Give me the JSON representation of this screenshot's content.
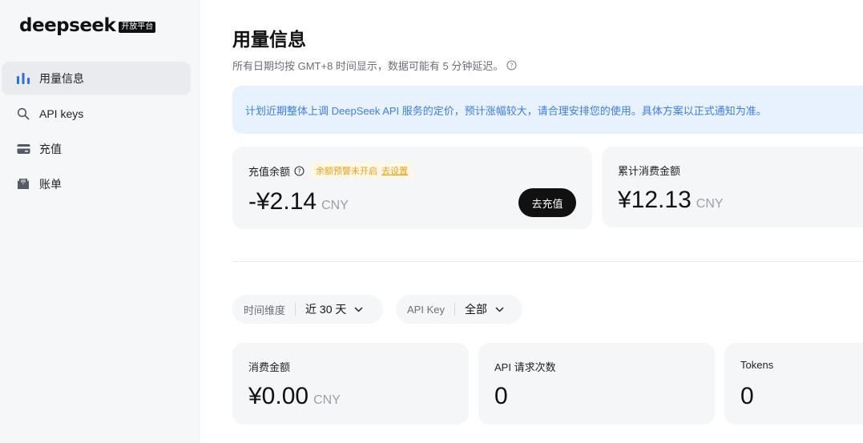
{
  "brand": {
    "name": "deepseek",
    "badge": "开放平台"
  },
  "sidebar": {
    "items": [
      {
        "label": "用量信息",
        "icon": "bar-chart-icon",
        "active": true
      },
      {
        "label": "API keys",
        "icon": "search-icon",
        "active": false
      },
      {
        "label": "充值",
        "icon": "wallet-icon",
        "active": false
      },
      {
        "label": "账单",
        "icon": "bill-icon",
        "active": false
      }
    ]
  },
  "header": {
    "title": "用量信息",
    "subtitle": "所有日期均按 GMT+8 时间显示，数据可能有 5 分钟延迟。"
  },
  "notice": {
    "text": "计划近期整体上调 DeepSeek API 服务的定价，预计涨幅较大，请合理安排您的使用。具体方案以正式通知为准。"
  },
  "balance": {
    "label": "充值余额",
    "warning": "余额预警未开启",
    "warning_link": "去设置",
    "value": "-¥2.14",
    "unit": "CNY",
    "button": "去充值"
  },
  "total_spend": {
    "label": "累计消费金额",
    "value": "¥12.13",
    "unit": "CNY"
  },
  "filters": {
    "time": {
      "key": "时间维度",
      "value": "近 30 天"
    },
    "api_key": {
      "key": "API Key",
      "value": "全部"
    }
  },
  "stats": {
    "spend": {
      "label": "消费金额",
      "value": "¥0.00",
      "unit": "CNY"
    },
    "requests": {
      "label": "API 请求次数",
      "value": "0"
    },
    "tokens": {
      "label": "Tokens",
      "value": "0"
    }
  },
  "colors": {
    "accent": "#3d7ee8",
    "notice_bg": "#e8f1fe",
    "warn": "#e8a317"
  }
}
